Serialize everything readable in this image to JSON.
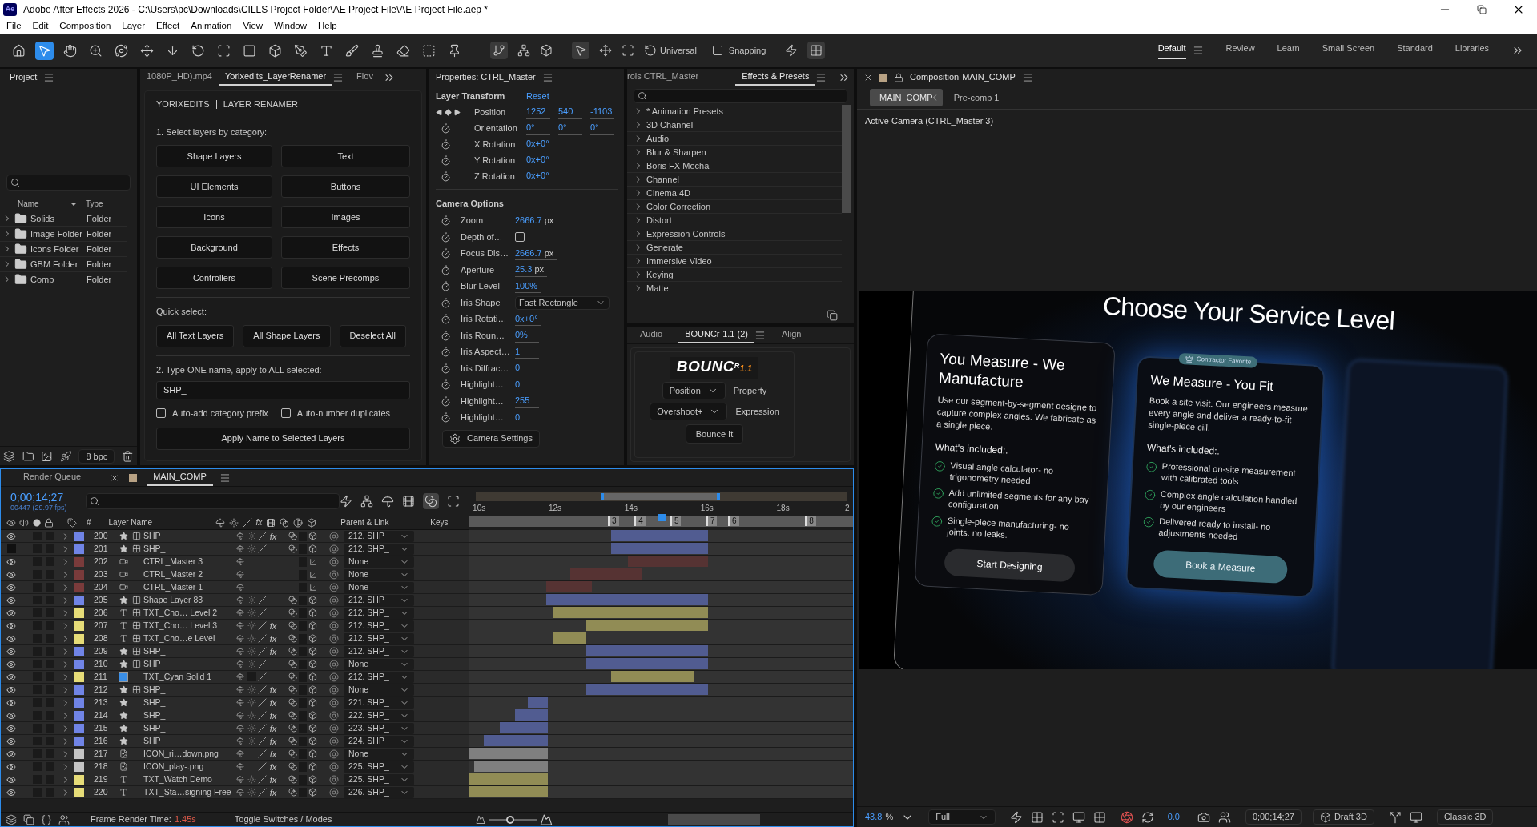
{
  "window": {
    "app_badge": "Ae",
    "title": "Adobe After Effects 2026 - C:\\Users\\pc\\Downloads\\CILLS Project Folder\\AE Project File\\AE Project File.aep *"
  },
  "menu": [
    "File",
    "Edit",
    "Composition",
    "Layer",
    "Effect",
    "Animation",
    "View",
    "Window",
    "Help"
  ],
  "toolbar": {
    "axis_mode": "Universal",
    "snapping": {
      "label": "Snapping",
      "checked": false
    }
  },
  "workspaces": [
    {
      "label": "Default",
      "selected": true
    },
    {
      "label": "Review",
      "selected": false
    },
    {
      "label": "Learn",
      "selected": false
    },
    {
      "label": "Small Screen",
      "selected": false
    },
    {
      "label": "Standard",
      "selected": false
    },
    {
      "label": "Libraries",
      "selected": false
    }
  ],
  "project": {
    "title": "Project",
    "columns": [
      "Name",
      "Type"
    ],
    "items": [
      {
        "name": "Solids",
        "type": "Folder"
      },
      {
        "name": "Image Folder",
        "type": "Folder"
      },
      {
        "name": "Icons Folder",
        "type": "Folder"
      },
      {
        "name": "GBM Folder",
        "type": "Folder"
      },
      {
        "name": "Comp",
        "type": "Folder"
      }
    ],
    "bpc": "8 bpc"
  },
  "renamer": {
    "tabs": [
      {
        "label": "1080P_HD).mp4",
        "selected": false
      },
      {
        "label": "Yorixedits_LayerRenamer",
        "selected": true
      },
      {
        "label": "Flov",
        "selected": false
      }
    ],
    "brand": "YORIXEDITS",
    "title": "LAYER RENAMER",
    "step1": "1. Select layers by category:",
    "categories": [
      "Shape Layers",
      "Text",
      "UI Elements",
      "Buttons",
      "Icons",
      "Images",
      "Background",
      "Effects",
      "Controllers",
      "Scene Precomps"
    ],
    "quick_label": "Quick select:",
    "quick": [
      "All Text Layers",
      "All Shape Layers",
      "Deselect All"
    ],
    "step2": "2. Type ONE name, apply to ALL selected:",
    "name_value": "SHP_",
    "options": [
      {
        "label": "Auto-add category prefix",
        "checked": false
      },
      {
        "label": "Auto-number duplicates",
        "checked": false
      }
    ],
    "apply": "Apply Name to Selected Layers"
  },
  "properties": {
    "title": "Properties: CTRL_Master",
    "section1": "Layer Transform",
    "reset": "Reset",
    "transform": [
      {
        "kind": "keyframe",
        "label": "Position",
        "values": [
          "1252",
          "540",
          "-1103"
        ]
      },
      {
        "kind": "stopwatch",
        "label": "Orientation",
        "values": [
          "0°",
          "0°",
          "0°"
        ]
      },
      {
        "kind": "stopwatch",
        "label": "X Rotation",
        "values": [
          "0x+0°"
        ]
      },
      {
        "kind": "stopwatch",
        "label": "Y Rotation",
        "values": [
          "0x+0°"
        ]
      },
      {
        "kind": "stopwatch",
        "label": "Z Rotation",
        "values": [
          "0x+0°"
        ]
      }
    ],
    "section2": "Camera Options",
    "camera": [
      {
        "kind": "value",
        "label": "Zoom",
        "value": "2666.7",
        "unit": "px"
      },
      {
        "kind": "checkbox",
        "label": "Depth of…",
        "checked": false
      },
      {
        "kind": "value",
        "label": "Focus Dis…",
        "value": "2666.7",
        "unit": "px"
      },
      {
        "kind": "value",
        "label": "Aperture",
        "value": "25.3",
        "unit": "px"
      },
      {
        "kind": "value",
        "label": "Blur Level",
        "value": "100%"
      },
      {
        "kind": "dropdown",
        "label": "Iris Shape",
        "value": "Fast Rectangle"
      },
      {
        "kind": "value",
        "label": "Iris Rotati…",
        "value": "0x+0°"
      },
      {
        "kind": "value",
        "label": "Iris Roun…",
        "value": "0%"
      },
      {
        "kind": "value",
        "label": "Iris Aspect…",
        "value": "1"
      },
      {
        "kind": "value",
        "label": "Iris Diffrac…",
        "value": "0"
      },
      {
        "kind": "value",
        "label": "Highlight…",
        "value": "0"
      },
      {
        "kind": "value",
        "label": "Highlight…",
        "value": "255"
      },
      {
        "kind": "value",
        "label": "Highlight…",
        "value": "0"
      }
    ],
    "settings_button": "Camera Settings"
  },
  "effects": {
    "tabs": [
      {
        "label": "rols CTRL_Master",
        "selected": false
      },
      {
        "label": "Effects & Presets",
        "selected": true
      }
    ],
    "items": [
      "* Animation Presets",
      "3D Channel",
      "Audio",
      "Blur & Sharpen",
      "Boris FX Mocha",
      "Channel",
      "Cinema 4D",
      "Color Correction",
      "Distort",
      "Expression Controls",
      "Generate",
      "Immersive Video",
      "Keying",
      "Matte"
    ]
  },
  "bouncr": {
    "tabs": [
      {
        "label": "Audio",
        "selected": false
      },
      {
        "label": "BOUNCr-1.1 (2)",
        "selected": true
      },
      {
        "label": "Align",
        "selected": false
      }
    ],
    "logo": "BOUNC",
    "logo_sup": "R",
    "logo_version": "1.1",
    "property_select": "Position",
    "property_label": "Property",
    "expression_select": "Overshoot+",
    "expression_label": "Expression",
    "button": "Bounce It"
  },
  "composition": {
    "title": "Composition",
    "comp_name": "MAIN_COMP",
    "breadcrumbs": [
      {
        "label": "MAIN_COMP",
        "selected": true
      },
      {
        "label": "Pre-comp 1",
        "selected": false
      }
    ],
    "camera_label": "Active Camera (CTRL_Master 3)",
    "frame": {
      "heading": "Choose Your Service Level",
      "cards": [
        {
          "featured": false,
          "title": "You Measure - We Manufacture",
          "body": "Use our segment-by-segment designe to capture complex angles. We fabricate as a single piece.",
          "included": "What's included:.",
          "features": [
            "Visual angle calculator- no trigonometry needed",
            "Add unlimited segments for any bay configuration",
            "Single-piece manufacturing- no joints. no leaks."
          ],
          "button": "Start Designing"
        },
        {
          "featured": true,
          "badge": "Contractor Favorite",
          "title": "We Measure - You Fit",
          "body": "Book a site visit. Our engineers measure every angle and deliver a ready-to-fit single-piece cill.",
          "included": "What's included:.",
          "features": [
            "Professional on-site measurement with calibrated tools",
            "Complex angle calculation handled by our engineers",
            "Delivered ready to install- no adjustments needed"
          ],
          "button": "Book a Measure"
        }
      ]
    },
    "footer": {
      "zoom": "43.8",
      "zoom_unit": "%",
      "resolution": "Full",
      "exposure": "+0.0",
      "timecode": "0;00;14;27",
      "renderer": "Draft 3D",
      "mode": "Classic 3D"
    }
  },
  "timeline": {
    "tabs": [
      {
        "label": "Render Queue",
        "selected": false
      },
      {
        "label": "MAIN_COMP",
        "selected": true
      }
    ],
    "timecode": "0;00;14;27",
    "frame_info": "00447 (29.97 fps)",
    "columns": {
      "number": "#",
      "name": "Layer Name",
      "fx": "fx",
      "parent": "Parent & Link",
      "keys": "Keys"
    },
    "ruler": [
      "10s",
      "12s",
      "14s",
      "16s",
      "18s",
      "2"
    ],
    "markers": [
      "3",
      "4",
      "5",
      "7",
      "6",
      "8"
    ],
    "layers": [
      {
        "number": "200",
        "kind": "shape",
        "name": "SHP_",
        "visible": true,
        "color": "#7084e6",
        "comp_icon": true,
        "fx": true,
        "fx_label": "fx",
        "parent": "212. SHP_"
      },
      {
        "number": "201",
        "kind": "shape",
        "name": "SHP_",
        "visible": false,
        "color": "#7084e6",
        "comp_icon": true,
        "fx": false,
        "parent": "212. SHP_"
      },
      {
        "number": "202",
        "kind": "camera",
        "name": "CTRL_Master 3",
        "visible": true,
        "color": "#7a3b3b",
        "comp_icon": false,
        "fx": false,
        "parent": "None"
      },
      {
        "number": "203",
        "kind": "camera",
        "name": "CTRL_Master 2",
        "visible": true,
        "color": "#7a3b3b",
        "comp_icon": false,
        "fx": false,
        "parent": "None"
      },
      {
        "number": "204",
        "kind": "camera",
        "name": "CTRL_Master 1",
        "visible": true,
        "color": "#7a3b3b",
        "comp_icon": false,
        "fx": false,
        "parent": "None"
      },
      {
        "number": "205",
        "kind": "shape",
        "name": "Shape Layer 83",
        "visible": true,
        "color": "#7084e6",
        "comp_icon": true,
        "fx": false,
        "parent": "212. SHP_"
      },
      {
        "number": "206",
        "kind": "text",
        "name": "TXT_Cho… Level 2",
        "visible": true,
        "color": "#e6dc78",
        "comp_icon": true,
        "fx": false,
        "parent": "212. SHP_"
      },
      {
        "number": "207",
        "kind": "text",
        "name": "TXT_Cho… Level 3",
        "visible": true,
        "color": "#e6dc78",
        "comp_icon": true,
        "fx": true,
        "fx_label": "fx",
        "parent": "212. SHP_"
      },
      {
        "number": "208",
        "kind": "text",
        "name": "TXT_Cho…e Level",
        "visible": true,
        "color": "#e6dc78",
        "comp_icon": true,
        "fx": true,
        "fx_label": "fx",
        "parent": "212. SHP_"
      },
      {
        "number": "209",
        "kind": "shape",
        "name": "SHP_",
        "visible": true,
        "color": "#7084e6",
        "comp_icon": true,
        "fx": true,
        "fx_label": "fx",
        "parent": "212. SHP_"
      },
      {
        "number": "210",
        "kind": "shape",
        "name": "SHP_",
        "visible": true,
        "color": "#7084e6",
        "comp_icon": true,
        "fx": false,
        "parent": "None"
      },
      {
        "number": "211",
        "kind": "solid",
        "name": "TXT_Cyan Solid 1",
        "visible": true,
        "color": "#e6dc78",
        "comp_icon": false,
        "fx": false,
        "parent": "212. SHP_"
      },
      {
        "number": "212",
        "kind": "shape",
        "name": "SHP_",
        "visible": true,
        "color": "#7084e6",
        "comp_icon": true,
        "fx": true,
        "fx_label": "fx",
        "parent": "None"
      },
      {
        "number": "213",
        "kind": "shape",
        "name": "SHP_",
        "visible": true,
        "color": "#7084e6",
        "comp_icon": false,
        "fx": true,
        "fx_label": "fx",
        "parent": "221. SHP_"
      },
      {
        "number": "214",
        "kind": "shape",
        "name": "SHP_",
        "visible": true,
        "color": "#7084e6",
        "comp_icon": false,
        "fx": true,
        "fx_label": "fx",
        "parent": "222. SHP_"
      },
      {
        "number": "215",
        "kind": "shape",
        "name": "SHP_",
        "visible": true,
        "color": "#7084e6",
        "comp_icon": false,
        "fx": true,
        "fx_label": "fx",
        "parent": "223. SHP_"
      },
      {
        "number": "216",
        "kind": "shape",
        "name": "SHP_",
        "visible": true,
        "color": "#7084e6",
        "comp_icon": false,
        "fx": true,
        "fx_label": "fx",
        "parent": "224. SHP_"
      },
      {
        "number": "217",
        "kind": "image",
        "name": "ICON_ri…down.png",
        "visible": true,
        "color": "#c4c4c4",
        "comp_icon": false,
        "fx": true,
        "fx_label": "fx",
        "parent": "None"
      },
      {
        "number": "218",
        "kind": "image",
        "name": "ICON_play-.png",
        "visible": true,
        "color": "#c4c4c4",
        "comp_icon": false,
        "fx": true,
        "fx_label": "fx",
        "parent": "225. SHP_"
      },
      {
        "number": "219",
        "kind": "text",
        "name": "TXT_Watch Demo",
        "visible": true,
        "color": "#e6dc78",
        "comp_icon": false,
        "fx": true,
        "fx_label": "fx",
        "parent": "225. SHP_"
      },
      {
        "number": "220",
        "kind": "text",
        "name": "TXT_Sta…signing Free",
        "visible": true,
        "color": "#e6dc78",
        "comp_icon": false,
        "fx": true,
        "fx_label": "fx",
        "parent": "226. SHP_"
      }
    ],
    "zoom_slider": {
      "level": 0.45
    },
    "footer": {
      "render_label": "Frame Render Time:",
      "render_time": "1.45s",
      "toggle": "Toggle Switches / Modes"
    }
  }
}
